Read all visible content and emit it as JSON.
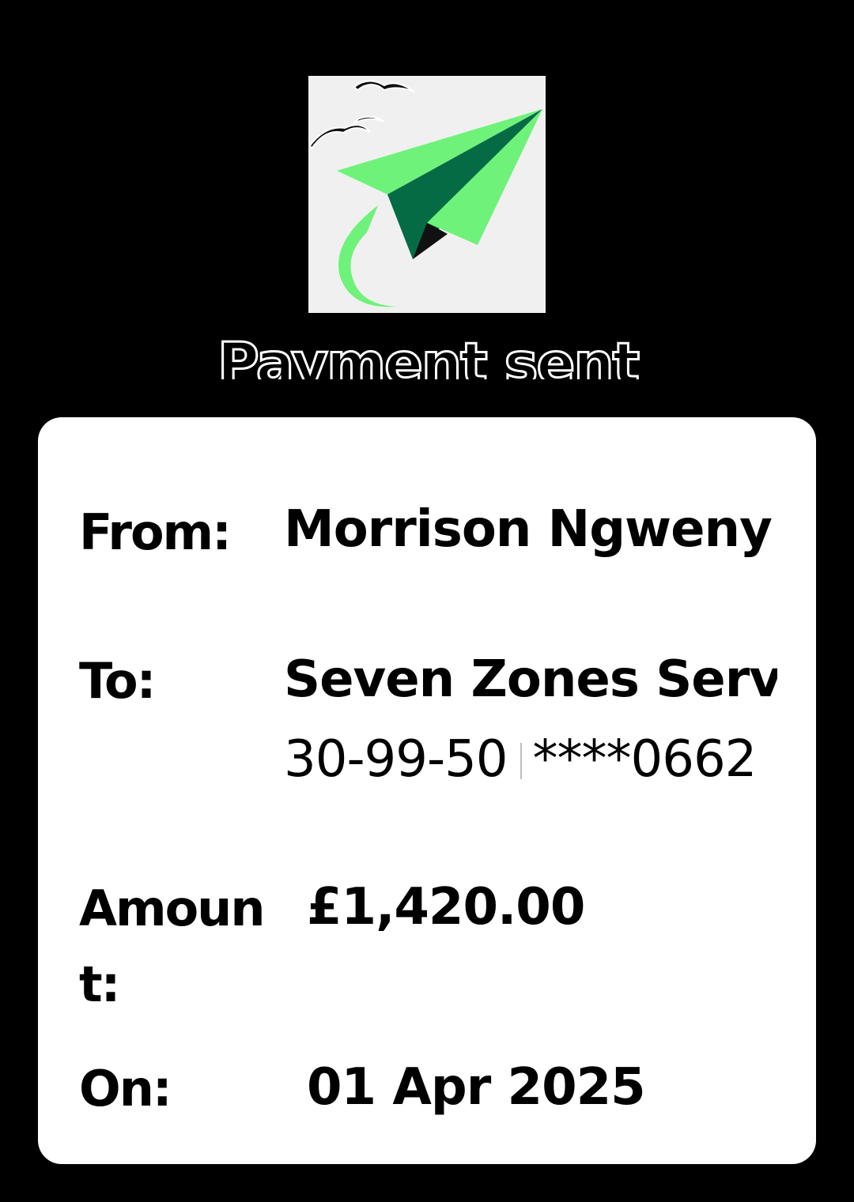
{
  "header": {
    "logo_icon": "paper-plane-icon",
    "title": "Payment sent"
  },
  "colors": {
    "background": "#000000",
    "card": "#ffffff",
    "plane_light": "#6ff27a",
    "plane_dark": "#046b45"
  },
  "receipt": {
    "from": {
      "label": "From:",
      "value": "Morrison Ngweny"
    },
    "to": {
      "label": "To:",
      "name": "Seven Zones Serv",
      "sort_code": "30-99-50",
      "account": "****0662"
    },
    "amount": {
      "label_line1": "Amoun",
      "label_line2": "t:",
      "value": "£1,420.00"
    },
    "on": {
      "label": "On:",
      "value": "01 Apr 2025"
    }
  }
}
